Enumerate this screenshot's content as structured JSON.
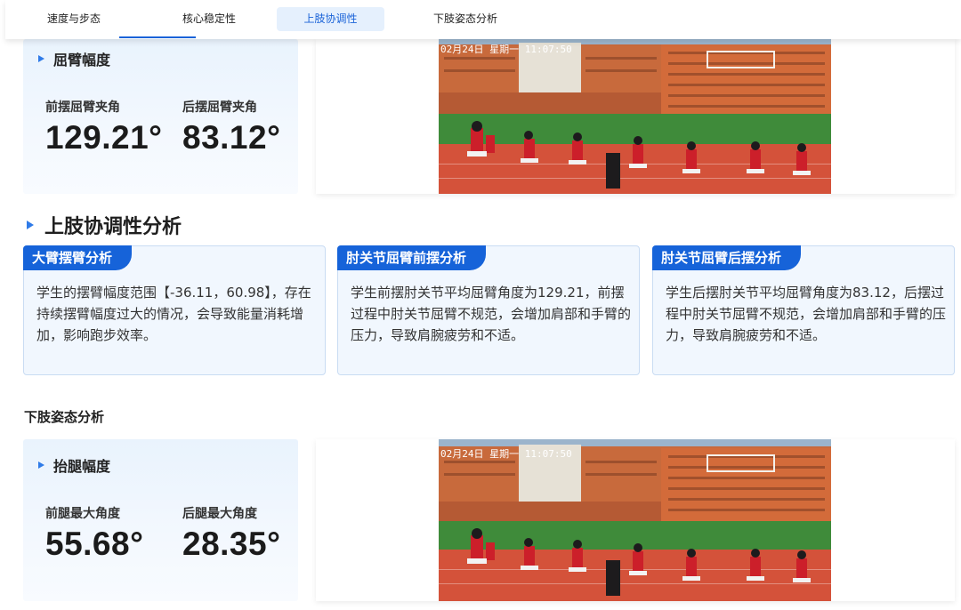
{
  "tabs": [
    {
      "label": "速度与步态"
    },
    {
      "label": "核心稳定性"
    },
    {
      "label": "上肢协调性"
    },
    {
      "label": "下肢姿态分析"
    }
  ],
  "arm_panel": {
    "title": "屈臂幅度",
    "metrics": [
      {
        "label": "前摆屈臂夹角",
        "value": "129.21°"
      },
      {
        "label": "后摆屈臂夹角",
        "value": "83.12°"
      }
    ],
    "video_overlay": "02月24日 星期一 11:07:50"
  },
  "upper_section": {
    "title": "上肢协调性分析",
    "cards": [
      {
        "tag": "大臂摆臂分析",
        "text": "学生的摆臂幅度范围【-36.11，60.98】，存在持续摆臂幅度过大的情况，会导致能量消耗增加，影响跑步效率。"
      },
      {
        "tag": "肘关节屈臂前摆分析",
        "text": "学生前摆肘关节平均屈臂角度为129.21，前摆过程中肘关节屈臂不规范，会增加肩部和手臂的压力，导致肩腕疲劳和不适。"
      },
      {
        "tag": "肘关节屈臂后摆分析",
        "text": "学生后摆肘关节平均屈臂角度为83.12，后摆过程中肘关节屈臂不规范，会增加肩部和手臂的压力，导致肩腕疲劳和不适。"
      }
    ]
  },
  "lower_section": {
    "title": "下肢姿态分析"
  },
  "leg_panel": {
    "title": "抬腿幅度",
    "metrics": [
      {
        "label": "前腿最大角度",
        "value": "55.68°"
      },
      {
        "label": "后腿最大角度",
        "value": "28.35°"
      }
    ],
    "video_overlay": "02月24日 星期一 11:07:50"
  },
  "colors": {
    "accent": "#1663d9",
    "tab_active_bg": "#e5f0fd",
    "card_bg": "#f1f7fe",
    "card_border": "#c9dcf3"
  },
  "icons": [
    "triangle-bullet-icon"
  ]
}
